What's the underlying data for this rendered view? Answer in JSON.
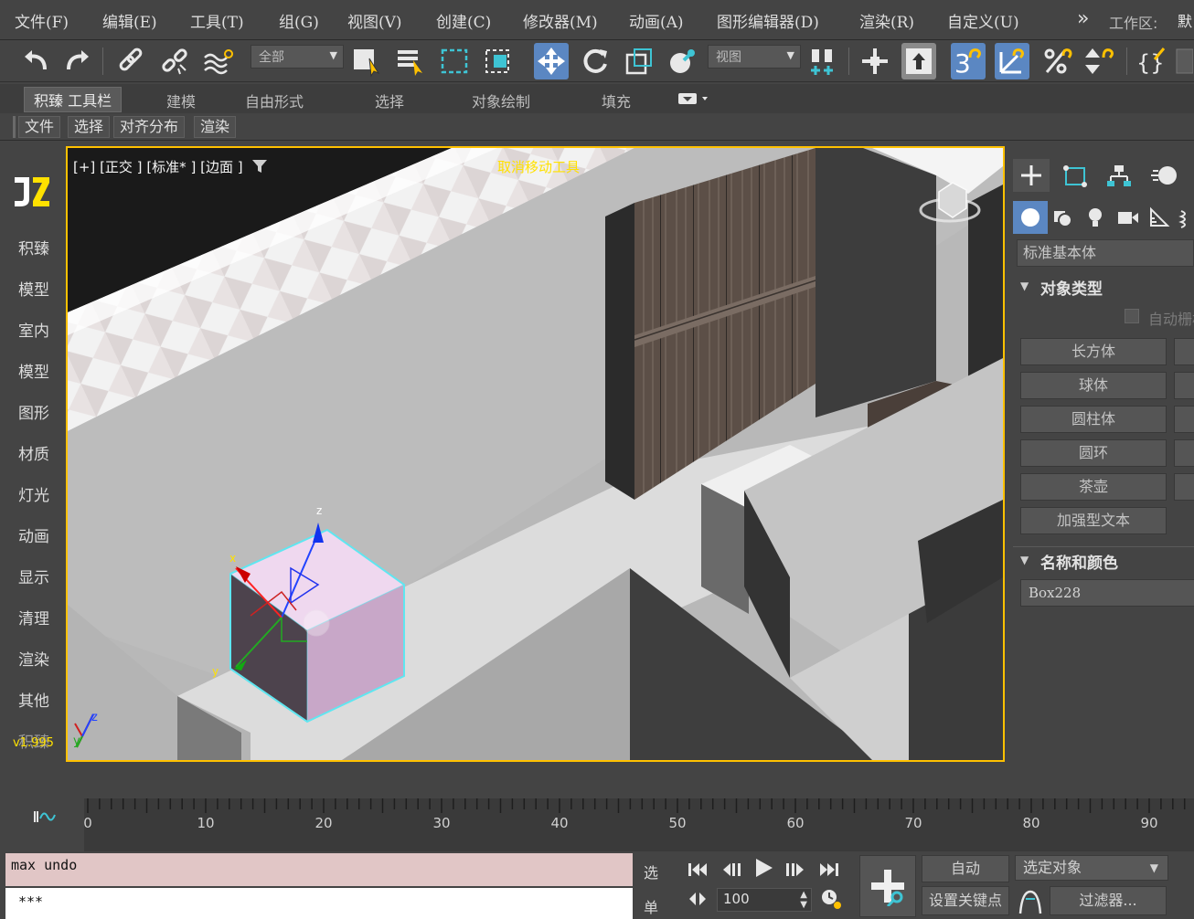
{
  "menu": [
    {
      "id": "file",
      "label": "文件(F)"
    },
    {
      "id": "edit",
      "label": "编辑(E)"
    },
    {
      "id": "tools",
      "label": "工具(T)"
    },
    {
      "id": "group",
      "label": "组(G)"
    },
    {
      "id": "view",
      "label": "视图(V)"
    },
    {
      "id": "create",
      "label": "创建(C)"
    },
    {
      "id": "modifiers",
      "label": "修改器(M)"
    },
    {
      "id": "animation",
      "label": "动画(A)"
    },
    {
      "id": "graph-editors",
      "label": "图形编辑器(D)"
    },
    {
      "id": "rendering",
      "label": "渲染(R)"
    },
    {
      "id": "customize",
      "label": "自定义(U)"
    }
  ],
  "workspace": {
    "chevron": "»",
    "label": "工作区:",
    "value": "默"
  },
  "toolbar": {
    "selection_filter": "全部",
    "ref_coord": "视图",
    "tool_numbers": {
      "snap": "3",
      "brace": "{}"
    }
  },
  "ribbon_tabs": [
    {
      "id": "jizhen",
      "label": "积臻 工具栏",
      "active": true
    },
    {
      "id": "modeling",
      "label": "建模"
    },
    {
      "id": "freeform",
      "label": "自由形式"
    },
    {
      "id": "selection",
      "label": "选择"
    },
    {
      "id": "object-paint",
      "label": "对象绘制"
    },
    {
      "id": "populate",
      "label": "填充"
    }
  ],
  "sub_tabs": [
    {
      "id": "file",
      "label": "文件"
    },
    {
      "id": "select",
      "label": "选择"
    },
    {
      "id": "align",
      "label": "对齐分布"
    },
    {
      "id": "render",
      "label": "渲染"
    }
  ],
  "left_menu": [
    "积臻",
    "模型",
    "室内",
    "模型",
    "图形",
    "材质",
    "灯光",
    "动画",
    "显示",
    "清理",
    "渲染",
    "其他"
  ],
  "left_footer": {
    "title": "积臻",
    "version": "v1.995"
  },
  "viewport": {
    "label_plus": "[+]",
    "label_view": "[正交 ]",
    "label_shading": "[标准* ]",
    "label_edges": "[边面 ]",
    "status": "取消移动工具",
    "gizmo": {
      "x": "x",
      "y": "y",
      "z": "z"
    }
  },
  "command_panel": {
    "category": "标准基本体",
    "object_type_title": "对象类型",
    "autogrid": "自动栅格",
    "objects": [
      "长方体",
      "球体",
      "圆柱体",
      "圆环",
      "茶壶",
      "加强型文本"
    ],
    "name_color_title": "名称和颜色",
    "object_name": "Box228"
  },
  "timeline": {
    "ticks": [
      0,
      10,
      20,
      30,
      40,
      50,
      60,
      70,
      80,
      90
    ],
    "max": 100
  },
  "bottom": {
    "script_line1": "max undo",
    "script_line2": "***",
    "select_label": "选",
    "single_label": "单",
    "frame_value": "100",
    "auto_key": "自动",
    "selected_object": "选定对象",
    "set_key": "设置关键点",
    "filters": "过滤器..."
  },
  "colors": {
    "accent_active": "#5b87c2",
    "viewport_border": "#ffc100",
    "status_text": "#ffe100",
    "script_bg": "#e1c6c6"
  }
}
